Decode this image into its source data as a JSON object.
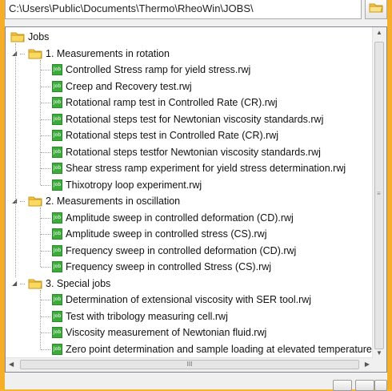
{
  "path": "C:\\Users\\Public\\Documents\\Thermo\\RheoWin\\JOBS\\",
  "tree": {
    "root": "Jobs",
    "groups": [
      {
        "label": "1. Measurements in rotation",
        "items": [
          "Controlled Stress ramp for yield stress.rwj",
          "Creep and Recovery test.rwj",
          "Rotational ramp test in Controlled Rate (CR).rwj",
          "Rotational steps test for Newtonian viscosity standards.rwj",
          "Rotational steps test in Controlled Rate (CR).rwj",
          "Rotational steps testfor Newtonian viscosity standards.rwj",
          "Shear stress ramp experiment for yield stress determination.rwj",
          "Thixotropy loop experiment.rwj"
        ]
      },
      {
        "label": "2. Measurements in oscillation",
        "items": [
          "Amplitude sweep in controlled deformation (CD).rwj",
          "Amplitude sweep in controlled stress (CS).rwj",
          "Frequency sweep in controlled deformation (CD).rwj",
          "Frequency sweep in controlled Stress (CS).rwj"
        ]
      },
      {
        "label": "3. Special jobs",
        "items": [
          "Determination of extensional viscosity with SER tool.rwj",
          "Test with tribology measuring cell.rwj",
          "Viscosity measurement of Newtonian fluid.rwj",
          "Zero point determination and sample loading at elevated temperature.rwj"
        ]
      }
    ]
  },
  "file_icon_text": "Job",
  "hscroll_grip": "III",
  "colors": {
    "frame": "#f4ae2a",
    "file_icon": "#3dab3b",
    "folder": "#f5c542"
  }
}
